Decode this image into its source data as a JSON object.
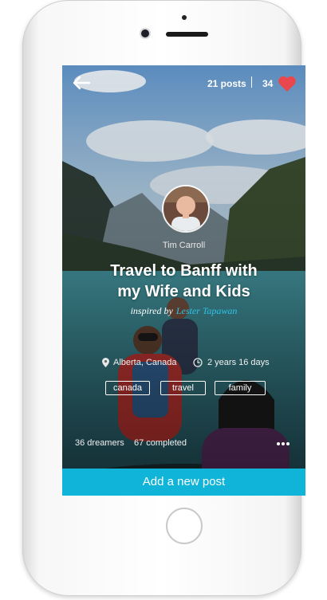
{
  "header": {
    "posts_count": "21 posts",
    "likes_count": "34",
    "back_icon": "arrow-left-icon",
    "heart_icon": "heart-icon",
    "heart_color": "#e8484d"
  },
  "dream": {
    "author": "Tim Carroll",
    "title_line1": "Travel to Banff with",
    "title_line2": "my Wife and Kids",
    "inspired_prefix": "inspired by",
    "inspired_name": "Lester Tapawan",
    "location": "Alberta, Canada",
    "duration": "2 years 16 days",
    "tags": [
      "canada",
      "travel",
      "family"
    ],
    "dreamers": "36 dreamers",
    "completed": "67 completed"
  },
  "actions": {
    "add_post_label": "Add a new post",
    "accent_color": "#0fb4d8"
  }
}
